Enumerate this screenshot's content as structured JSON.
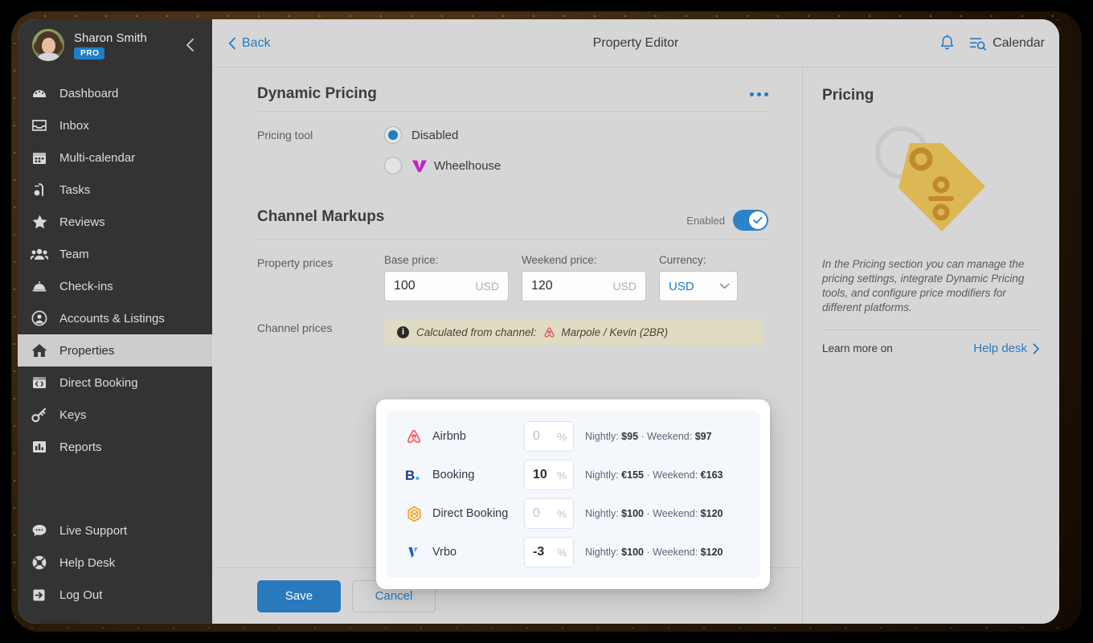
{
  "sidebar": {
    "user": {
      "name": "Sharon Smith",
      "badge": "PRO"
    },
    "collapse_icon": "chevron-left-icon",
    "items": [
      {
        "label": "Dashboard",
        "icon": "dashboard-icon",
        "active": false
      },
      {
        "label": "Inbox",
        "icon": "inbox-icon",
        "active": false
      },
      {
        "label": "Multi-calendar",
        "icon": "calendar-icon",
        "active": false
      },
      {
        "label": "Tasks",
        "icon": "tasks-icon",
        "active": false
      },
      {
        "label": "Reviews",
        "icon": "star-icon",
        "active": false
      },
      {
        "label": "Team",
        "icon": "people-icon",
        "active": false
      },
      {
        "label": "Check-ins",
        "icon": "bell-desk-icon",
        "active": false
      },
      {
        "label": "Accounts & Listings",
        "icon": "account-circle-icon",
        "active": false
      },
      {
        "label": "Properties",
        "icon": "home-icon",
        "active": true
      },
      {
        "label": "Direct Booking",
        "icon": "code-window-icon",
        "active": false
      },
      {
        "label": "Keys",
        "icon": "key-icon",
        "active": false
      },
      {
        "label": "Reports",
        "icon": "bar-chart-icon",
        "active": false
      }
    ],
    "bottom_items": [
      {
        "label": "Live Support",
        "icon": "chat-bubble-icon"
      },
      {
        "label": "Help Desk",
        "icon": "lifebuoy-icon"
      },
      {
        "label": "Log Out",
        "icon": "logout-icon"
      }
    ]
  },
  "topbar": {
    "back_label": "Back",
    "title": "Property Editor",
    "bell_icon": "notification-bell-icon",
    "calendar_icon": "calendar-search-icon",
    "calendar_label": "Calendar"
  },
  "dynamic_pricing": {
    "title": "Dynamic Pricing",
    "menu_icon": "more-options-icon",
    "field_label": "Pricing tool",
    "options": [
      {
        "label": "Disabled",
        "selected": true,
        "logo": null
      },
      {
        "label": "Wheelhouse",
        "selected": false,
        "logo": "wheelhouse-icon"
      }
    ]
  },
  "channel_markups": {
    "title": "Channel Markups",
    "toggle_label": "Enabled",
    "toggle_on": true,
    "property_prices_label": "Property prices",
    "base_price": {
      "caption": "Base price:",
      "value": "100",
      "suffix": "USD"
    },
    "weekend_price": {
      "caption": "Weekend price:",
      "value": "120",
      "suffix": "USD"
    },
    "currency": {
      "caption": "Currency:",
      "value": "USD"
    },
    "channel_prices_label": "Channel prices",
    "notice": {
      "icon": "info-icon",
      "text": "Calculated from channel:",
      "channel_icon": "airbnb-icon",
      "channel_name": "Marpole / Kevin (2BR)"
    }
  },
  "channel_card": {
    "percent_symbol": "%",
    "rows": [
      {
        "name": "Airbnb",
        "icon": "airbnb-icon",
        "icon_color": "#ff5a5f",
        "percent": "0",
        "percent_empty": true,
        "nightly_label": "Nightly:",
        "nightly_value": "$95",
        "separator": "·",
        "weekend_label": "Weekend:",
        "weekend_value": "$97"
      },
      {
        "name": "Booking",
        "icon": "booking-icon",
        "icon_color": "#1e3a8a",
        "percent": "10",
        "percent_empty": false,
        "nightly_label": "Nightly:",
        "nightly_value": "€155",
        "separator": "·",
        "weekend_label": "Weekend:",
        "weekend_value": "€163"
      },
      {
        "name": "Direct Booking",
        "icon": "direct-booking-icon",
        "icon_color": "#f5a623",
        "percent": "0",
        "percent_empty": true,
        "nightly_label": "Nightly:",
        "nightly_value": "$100",
        "separator": "·",
        "weekend_label": "Weekend:",
        "weekend_value": "$120"
      },
      {
        "name": "Vrbo",
        "icon": "vrbo-icon",
        "icon_color": "#2558b6",
        "percent": "-3",
        "percent_empty": false,
        "nightly_label": "Nightly:",
        "nightly_value": "$100",
        "separator": "·",
        "weekend_label": "Weekend:",
        "weekend_value": "$120"
      }
    ]
  },
  "help_panel": {
    "title": "Pricing",
    "art_icon": "price-tag-icon",
    "description": "In the Pricing section you can manage the pricing settings, integrate Dynamic Pricing tools, and configure price modifiers for different platforms.",
    "learn_more_label": "Learn more on",
    "link_label": "Help desk",
    "link_icon": "chevron-right-icon"
  },
  "footer": {
    "save_label": "Save",
    "cancel_label": "Cancel"
  },
  "colors": {
    "accent_blue": "#2a79bd",
    "sidebar_bg": "#333333",
    "page_bg": "#d6d6d6",
    "notice_bg": "#e0dcc4",
    "tag_yellow": "#d9b košt"
  }
}
